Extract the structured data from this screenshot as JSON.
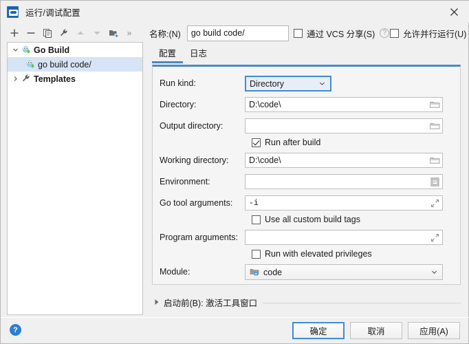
{
  "window": {
    "title": "运行/调试配置",
    "app_icon": "go-logo-icon",
    "close_label": "×"
  },
  "toolbar": {
    "items": [
      {
        "name": "add-button",
        "icon": "plus-icon",
        "label": "+"
      },
      {
        "name": "remove-button",
        "icon": "minus-icon",
        "label": "−"
      },
      {
        "name": "copy-button",
        "icon": "copy-icon",
        "label": ""
      },
      {
        "name": "edit-templates-button",
        "icon": "wrench-icon",
        "label": ""
      },
      {
        "name": "move-up-button",
        "icon": "arrow-up-icon",
        "label": ""
      },
      {
        "name": "move-down-button",
        "icon": "arrow-down-icon",
        "label": ""
      },
      {
        "name": "new-folder-button",
        "icon": "folder-plus-icon",
        "label": ""
      }
    ],
    "overflow_label": "»"
  },
  "name_field": {
    "label": "名称:(N)",
    "value": "go build code/",
    "placeholder": ""
  },
  "share_vcs": {
    "label": "通过 VCS 分享(S)",
    "checked": false,
    "help_glyph": "?"
  },
  "allow_parallel": {
    "label": "允许并行运行(U)",
    "checked": false
  },
  "tree": {
    "items": [
      {
        "label": "Go Build",
        "icon": "go-gopher-icon",
        "expanded": true,
        "selected": false,
        "level": 0,
        "twisty": "chevron-down-icon"
      },
      {
        "label": "go build code/",
        "icon": "go-gopher-icon",
        "expanded": false,
        "selected": true,
        "level": 1,
        "twisty": ""
      },
      {
        "label": "Templates",
        "icon": "wrench-icon",
        "expanded": false,
        "selected": false,
        "level": 0,
        "twisty": "chevron-right-icon"
      }
    ]
  },
  "tabs": [
    {
      "label": "配置",
      "active": true
    },
    {
      "label": "日志",
      "active": false
    }
  ],
  "form": {
    "run_kind": {
      "label": "Run kind:",
      "value": "Directory",
      "focused": true
    },
    "directory": {
      "label": "Directory:",
      "value": "D:\\code\\",
      "icon": "folder-icon"
    },
    "output_directory": {
      "label": "Output directory:",
      "value": "",
      "icon": "folder-icon"
    },
    "run_after_build": {
      "label": "Run after build",
      "checked": true
    },
    "working_directory": {
      "label": "Working directory:",
      "value": "D:\\code\\",
      "icon": "folder-icon"
    },
    "environment": {
      "label": "Environment:",
      "value": "",
      "icon": "list-edit-icon"
    },
    "go_tool_arguments": {
      "label": "Go tool arguments:",
      "value": "-i",
      "icon": "expand-icon"
    },
    "use_custom_build_tags": {
      "label": "Use all custom build tags",
      "checked": false
    },
    "program_arguments": {
      "label": "Program arguments:",
      "value": "",
      "icon": "expand-icon"
    },
    "run_elevated": {
      "label": "Run with elevated privileges",
      "checked": false
    },
    "module": {
      "label": "Module:",
      "value": "code",
      "icon": "module-icon"
    }
  },
  "before_launch": {
    "label": "启动前(B): 激活工具窗口",
    "expanded": false,
    "twisty": "triangle-right-icon"
  },
  "footer": {
    "help_glyph": "?",
    "buttons": [
      {
        "label": "确定",
        "default": true,
        "name": "ok-button"
      },
      {
        "label": "取消",
        "default": false,
        "name": "cancel-button"
      },
      {
        "label": "应用(A)",
        "default": false,
        "name": "apply-button"
      }
    ]
  },
  "colors": {
    "accent": "#3f8bd8",
    "tab_underline": "#4a88c7",
    "selection": "#d6e4f5",
    "help_blue": "#2a7fd4",
    "window_bg": "#f0f0f0",
    "panel_bg": "#f5f5f5"
  }
}
